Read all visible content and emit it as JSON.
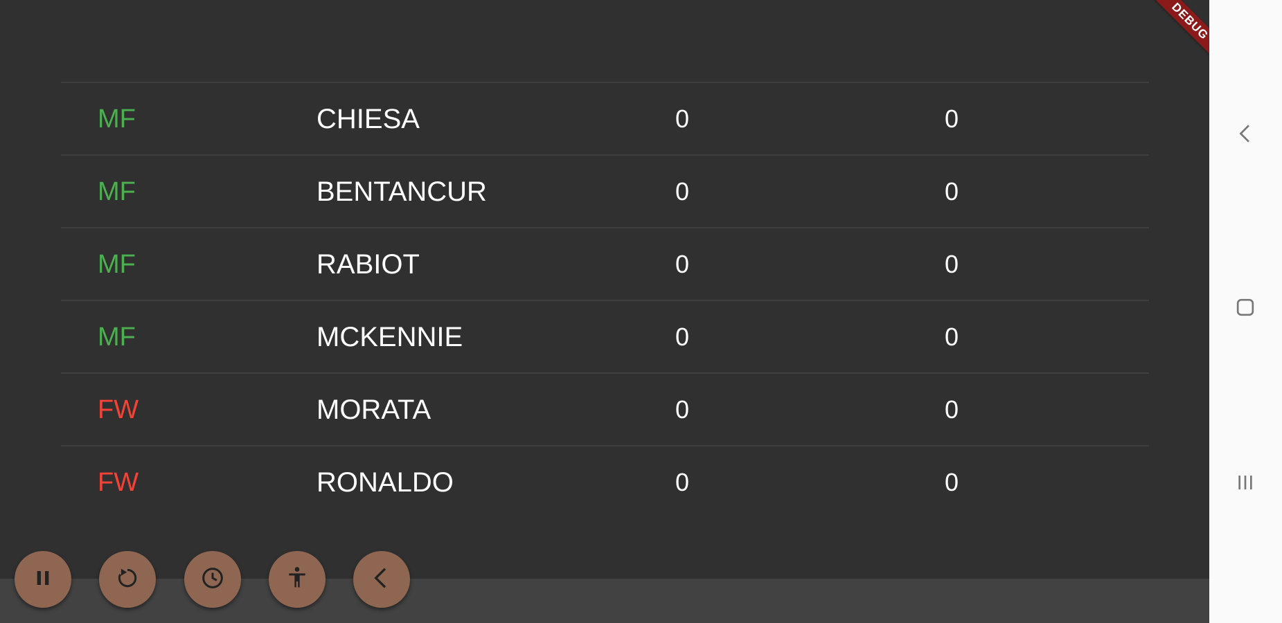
{
  "debug_banner": "DEBUG",
  "players": [
    {
      "position": "MF",
      "position_color": "#4caf50",
      "name": "CHIESA",
      "stat1": "0",
      "stat2": "0"
    },
    {
      "position": "MF",
      "position_color": "#4caf50",
      "name": "BENTANCUR",
      "stat1": "0",
      "stat2": "0"
    },
    {
      "position": "MF",
      "position_color": "#4caf50",
      "name": "RABIOT",
      "stat1": "0",
      "stat2": "0"
    },
    {
      "position": "MF",
      "position_color": "#4caf50",
      "name": "MCKENNIE",
      "stat1": "0",
      "stat2": "0"
    },
    {
      "position": "FW",
      "position_color": "#f44336",
      "name": "MORATA",
      "stat1": "0",
      "stat2": "0"
    },
    {
      "position": "FW",
      "position_color": "#f44336",
      "name": "RONALDO",
      "stat1": "0",
      "stat2": "0"
    }
  ],
  "toolbar": [
    {
      "icon": "pause-icon"
    },
    {
      "icon": "restart-icon"
    },
    {
      "icon": "clock-icon"
    },
    {
      "icon": "accessibility-icon"
    },
    {
      "icon": "back-chevron-icon"
    }
  ],
  "nav_bar": [
    {
      "icon": "back-icon"
    },
    {
      "icon": "home-icon"
    },
    {
      "icon": "recents-icon"
    }
  ],
  "colors": {
    "background": "#303030",
    "bottom_strip": "#424242",
    "fab": "#8f6652",
    "midfielder": "#4caf50",
    "forward": "#f44336",
    "debug_banner": "#8b1a1a"
  }
}
